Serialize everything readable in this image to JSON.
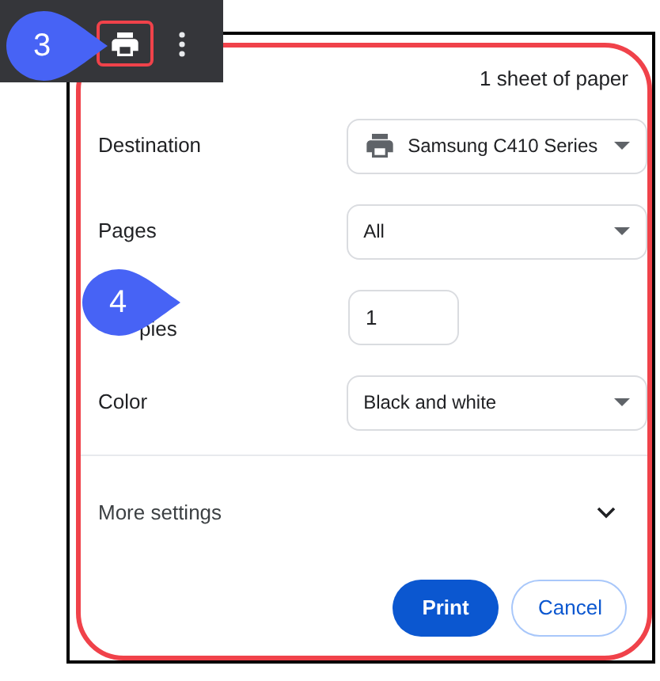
{
  "toolbar": {
    "badge": "3"
  },
  "summary": "1 sheet of paper",
  "settings": [
    {
      "kind": "select",
      "label": "Destination",
      "value": "Samsung C410 Series",
      "printer_icon": true
    },
    {
      "kind": "select",
      "label": "Pages",
      "value": "All",
      "printer_icon": false
    },
    {
      "kind": "input",
      "label": "pies",
      "value": "1"
    },
    {
      "kind": "select",
      "label": "Color",
      "value": "Black and white",
      "printer_icon": false
    }
  ],
  "more_settings": {
    "label": "More settings",
    "expanded": false
  },
  "buttons": [
    {
      "label": "Print",
      "primary": true
    },
    {
      "label": "Cancel",
      "primary": false
    }
  ],
  "callout": {
    "badge": "4"
  }
}
